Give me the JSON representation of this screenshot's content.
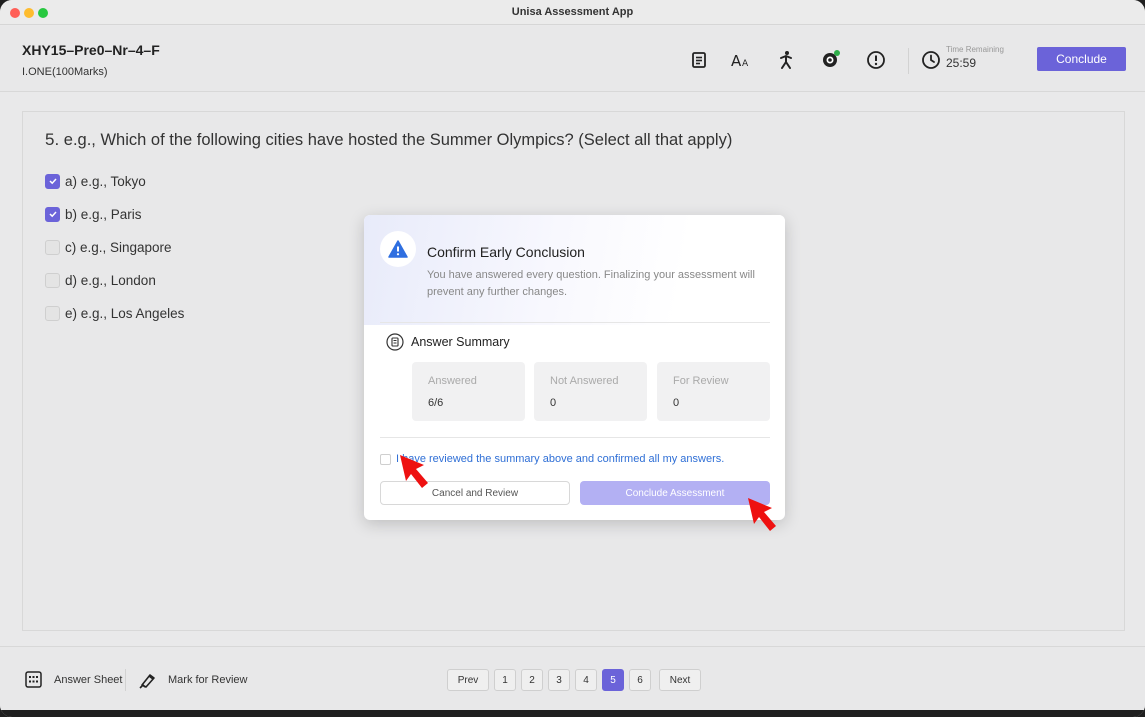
{
  "window": {
    "title": "Unisa Assessment App"
  },
  "header": {
    "exam_title": "XHY15–Pre0–Nr–4–F",
    "exam_subtitle": "I.ONE(100Marks)",
    "icons": [
      "document-icon",
      "font-size-icon",
      "accessibility-icon",
      "webcam-icon",
      "alert-icon",
      "clock-icon"
    ],
    "timer_label": "Time Remaining",
    "timer_value": "25:59",
    "conclude_label": "Conclude",
    "accent_color": "#6b63d9"
  },
  "question": {
    "number": "5.",
    "text": "e.g., Which of the following cities have hosted the Summer Olympics? (Select all that apply)",
    "options": [
      {
        "label": "a) e.g., Tokyo",
        "checked": true
      },
      {
        "label": "b) e.g., Paris",
        "checked": true
      },
      {
        "label": "c) e.g., Singapore",
        "checked": false
      },
      {
        "label": "d) e.g., London",
        "checked": false
      },
      {
        "label": "e) e.g., Los Angeles",
        "checked": false
      }
    ]
  },
  "modal": {
    "title": "Confirm Early Conclusion",
    "description": "You have answered every question. Finalizing your assessment will prevent any further changes.",
    "summary_title": "Answer Summary",
    "cards": [
      {
        "label": "Answered",
        "value": "6/6"
      },
      {
        "label": "Not Answered",
        "value": "0"
      },
      {
        "label": "For Review",
        "value": "0"
      }
    ],
    "confirm_text": "I have reviewed the summary above and confirmed all my answers.",
    "cancel_label": "Cancel and Review",
    "conclude_label": "Conclude Assessment"
  },
  "footer": {
    "answer_sheet_label": "Answer Sheet",
    "mark_review_label": "Mark for Review",
    "prev_label": "Prev",
    "next_label": "Next",
    "pages": [
      "1",
      "2",
      "3",
      "4",
      "5",
      "6"
    ],
    "current_page": "5"
  }
}
